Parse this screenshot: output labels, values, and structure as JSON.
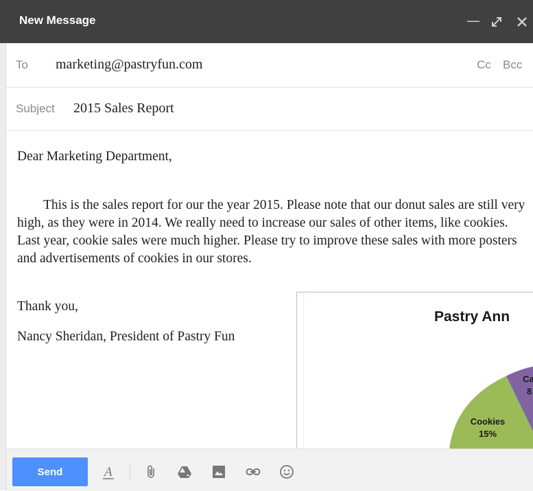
{
  "window": {
    "title": "New Message"
  },
  "to": {
    "label": "To",
    "value": "marketing@pastryfun.com",
    "cc": "Cc",
    "bcc": "Bcc"
  },
  "subject": {
    "label": "Subject",
    "value": "2015 Sales Report"
  },
  "body": {
    "greeting": "Dear Marketing Department,",
    "paragraph": "This is the sales report for our the year 2015.  Please note that our donut sales are still very high, as they were in 2014.  We really need to increase our sales of other items, like cookies.  Last year, cookie sales were much higher.  Please try to improve these sales with more posters and advertisements of cookies in our stores.",
    "closing": "Thank you,",
    "signature": "Nancy Sheridan, President of Pastry Fun"
  },
  "chart": {
    "title_visible": "Pastry Ann",
    "cookies_label": "Cookies",
    "cookies_pct": "15%",
    "cakes_label_partial": "Ca",
    "cakes_pct_partial": "8",
    "colors": {
      "cookies": "#9bbb59",
      "cakes": "#8064a2",
      "other": "#c0504d"
    }
  },
  "toolbar": {
    "send_label": "Send",
    "icons": [
      "formatting-icon",
      "attach-icon",
      "drive-icon",
      "photo-icon",
      "link-icon",
      "emoji-icon"
    ]
  }
}
